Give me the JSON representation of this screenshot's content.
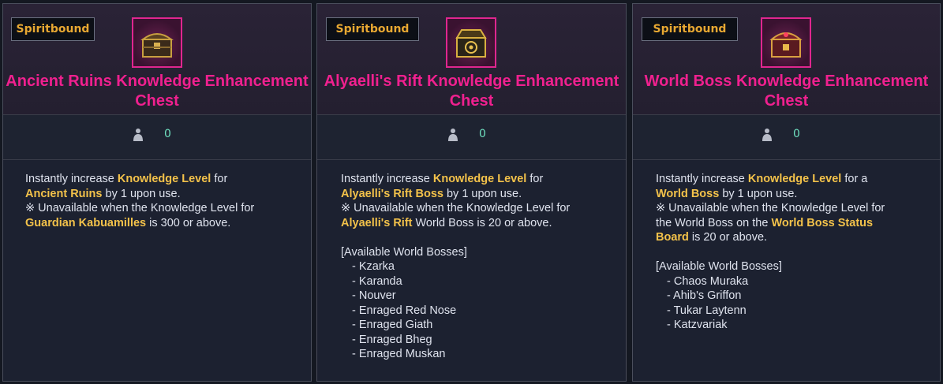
{
  "cards": [
    {
      "badge": "Spiritbound",
      "title_line1": "Ancient Ruins Knowledge Enhancement",
      "title_line2": "Chest",
      "count": "0",
      "desc": {
        "l1a": "Instantly increase ",
        "l1b": "Knowledge Level",
        "l1c": " for",
        "l2a": "Ancient Ruins",
        "l2b": " by 1 upon use.",
        "l3": "※ Unavailable when the Knowledge Level for",
        "l4a": "Guardian Kabuamilles",
        "l4b": " is 300 or above."
      }
    },
    {
      "badge": "Spiritbound",
      "title_line1": "Alyaelli's Rift Knowledge Enhancement",
      "title_line2": "Chest",
      "count": "0",
      "desc": {
        "l1a": "Instantly increase ",
        "l1b": "Knowledge Level",
        "l1c": " for",
        "l2a": "Alyaelli's Rift Boss",
        "l2b": " by 1 upon use.",
        "l3": "※ Unavailable when the Knowledge Level for",
        "l4a": "Alyaelli's Rift",
        "l4b": " World Boss is 20 or above.",
        "list_header": "[Available World Bosses]",
        "bosses": [
          "- Kzarka",
          "- Karanda",
          "- Nouver",
          "- Enraged Red Nose",
          "- Enraged Giath",
          "- Enraged Bheg",
          "- Enraged Muskan"
        ]
      }
    },
    {
      "badge": "Spiritbound",
      "title_line1": "World Boss Knowledge Enhancement",
      "title_line2": "Chest",
      "count": "0",
      "desc": {
        "l1a": "Instantly increase ",
        "l1b": "Knowledge Level",
        "l1c": " for a",
        "l2a": "World Boss",
        "l2b": " by 1 upon use.",
        "l3": "※ Unavailable when the Knowledge Level for",
        "l4a": "the World Boss on the ",
        "l4b": "World Boss Status",
        "l5a": "Board",
        "l5b": " is 20 or above.",
        "list_header": "[Available World Bosses]",
        "bosses": [
          "- Chaos Muraka",
          "- Ahib's Griffon",
          "- Tukar Laytenn",
          "- Katzvariak"
        ]
      }
    }
  ],
  "colors": {
    "title": "#f0208f",
    "highlight": "#f3c24a",
    "badge_text": "#e8a832",
    "count": "#6fe0c0"
  },
  "icons": [
    "treasure-chest-icon",
    "person-icon"
  ]
}
